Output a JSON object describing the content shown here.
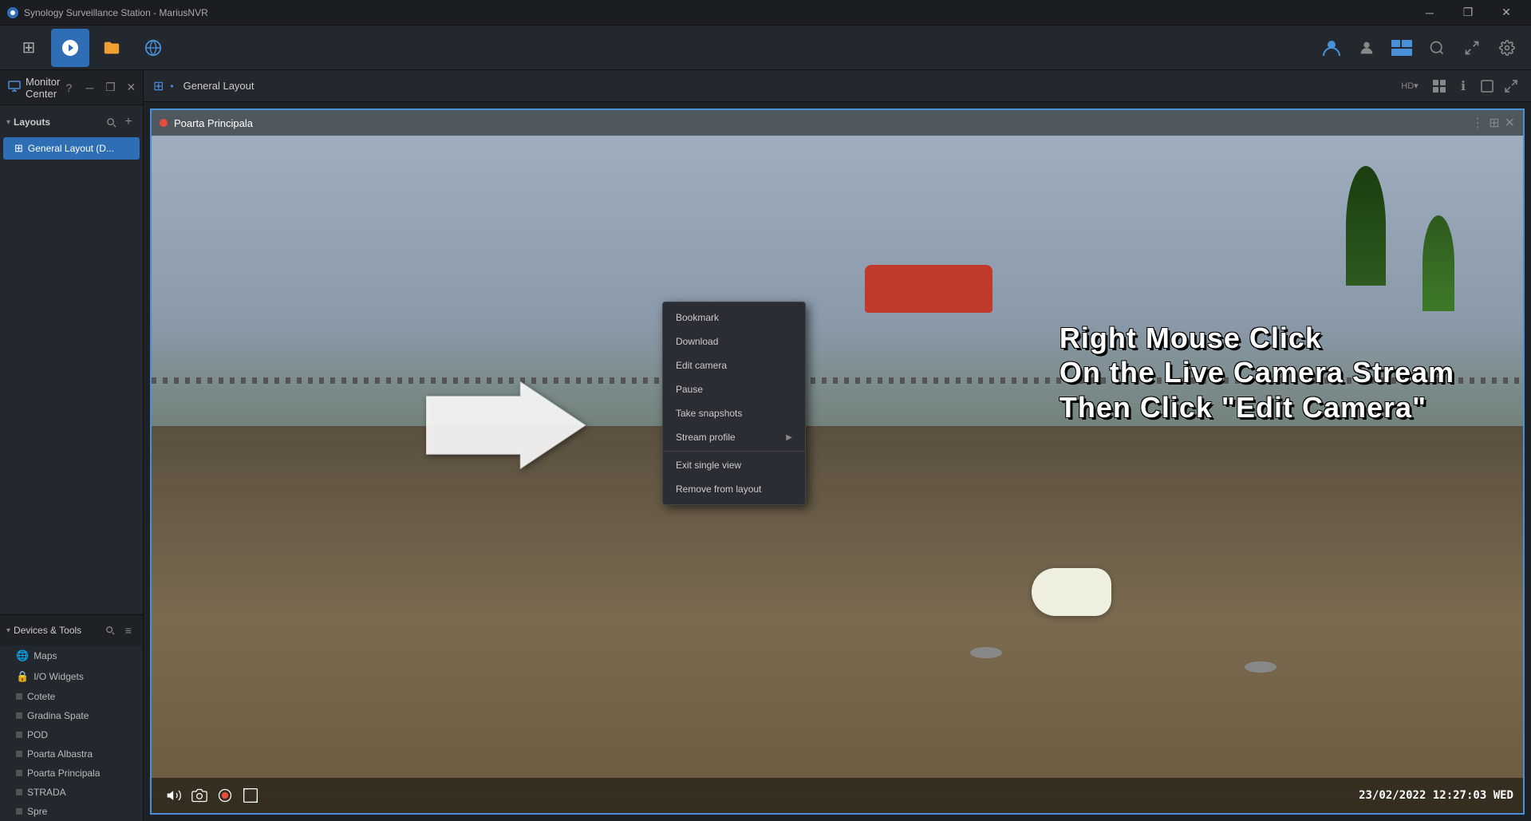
{
  "titlebar": {
    "title": "Synology Surveillance Station - MariusNVR",
    "min_label": "─",
    "max_label": "□",
    "restore_label": "❐",
    "close_label": "✕"
  },
  "toolbar": {
    "icons": [
      {
        "name": "grid-icon",
        "symbol": "⊞",
        "active": false
      },
      {
        "name": "camera-icon",
        "symbol": "📷",
        "active": true
      },
      {
        "name": "folder-icon",
        "symbol": "📁",
        "active": false
      },
      {
        "name": "network-icon",
        "symbol": "🔵",
        "active": false
      }
    ],
    "right_icons": [
      {
        "name": "user-avatar-icon",
        "symbol": "👤"
      },
      {
        "name": "person-icon",
        "symbol": "👤"
      },
      {
        "name": "layout-icon",
        "symbol": "⊟"
      },
      {
        "name": "search-icon",
        "symbol": "🔍"
      },
      {
        "name": "fullscreen-icon",
        "symbol": "⛶"
      },
      {
        "name": "settings-icon",
        "symbol": "⚙"
      }
    ]
  },
  "monitor_center": {
    "title": "Monitor Center",
    "help_label": "?",
    "minimize_label": "─",
    "restore_label": "❐",
    "close_label": "✕"
  },
  "layouts_section": {
    "title": "Layouts",
    "chevron": "▾",
    "items": [
      {
        "label": "General Layout (D...",
        "active": true
      }
    ]
  },
  "devices_section": {
    "title": "Devices & Tools",
    "chevron": "▾",
    "items": [
      {
        "label": "Maps",
        "icon": "globe"
      },
      {
        "label": "I/O Widgets",
        "icon": "lock"
      },
      {
        "label": "Cotete",
        "icon": "camera",
        "dot_color": "gray"
      },
      {
        "label": "Gradina Spate",
        "icon": "camera",
        "dot_color": "gray"
      },
      {
        "label": "POD",
        "icon": "camera",
        "dot_color": "gray"
      },
      {
        "label": "Poarta Albastra",
        "icon": "camera",
        "dot_color": "gray"
      },
      {
        "label": "Poarta Principala",
        "icon": "camera",
        "dot_color": "gray"
      },
      {
        "label": "STRADA",
        "icon": "camera",
        "dot_color": "gray"
      },
      {
        "label": "Spre",
        "icon": "camera",
        "dot_color": "gray"
      }
    ]
  },
  "layout_toolbar": {
    "grid_icon": "⊞",
    "separator": "•",
    "layout_name": "General Layout",
    "btn_resolution": "HD▾",
    "btn_grid": "⊞",
    "btn_fullscreen": "⛶",
    "btn_info": "ℹ",
    "btn_window": "⊡",
    "btn_expand": "⤢"
  },
  "camera": {
    "name": "Poarta Principala",
    "status": "recording",
    "timestamp": "23/02/2022  12:27:03  WED",
    "header_btns": [
      "⋮",
      "⊞",
      "✕"
    ]
  },
  "context_menu": {
    "items": [
      {
        "label": "Bookmark",
        "has_submenu": false
      },
      {
        "label": "Download",
        "has_submenu": false
      },
      {
        "label": "Edit camera",
        "has_submenu": false
      },
      {
        "label": "Pause",
        "has_submenu": false
      },
      {
        "label": "Take snapshots",
        "has_submenu": false
      },
      {
        "label": "Stream profile",
        "has_submenu": true
      },
      {
        "label": "Exit single view",
        "has_submenu": false
      },
      {
        "label": "Remove from layout",
        "has_submenu": false
      }
    ]
  },
  "instruction": {
    "line1": "Right Mouse Click",
    "line2": "On the Live Camera Stream",
    "line3": "Then Click \"Edit Camera\""
  },
  "footer_buttons": [
    {
      "name": "volume-icon",
      "symbol": "🔊"
    },
    {
      "name": "snapshot-icon",
      "symbol": "📷"
    },
    {
      "name": "record-icon",
      "symbol": "⏺"
    },
    {
      "name": "fit-icon",
      "symbol": "⊡"
    }
  ]
}
